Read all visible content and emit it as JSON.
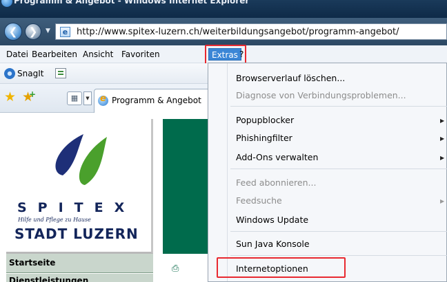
{
  "window": {
    "title": "Programm & Angebot - Windows Internet Explorer"
  },
  "address_bar": {
    "url": "http://www.spitex-luzern.ch/weiterbildungsangebot/programm-angebot/"
  },
  "menu_bar": {
    "items": [
      "Datei",
      "Bearbeiten",
      "Ansicht",
      "Favoriten",
      "Extras",
      "?"
    ],
    "active": "Extras"
  },
  "toolbar": {
    "snagit_label": "SnagIt"
  },
  "favorites_bar": {
    "tab_title": "Programm & Angebot"
  },
  "page": {
    "logo": {
      "word": "SPITEX",
      "tagline": "Hilfe und Pflege zu Hause",
      "city": "STADT LUZERN"
    },
    "nav": [
      "Startseite",
      "Dienstleistungen"
    ],
    "brand_colors": {
      "green": "#006b4c",
      "navy": "#13255a",
      "nav_bg": "#c9d6cc"
    }
  },
  "extras_menu": {
    "items": [
      {
        "label": "Browserverlauf löschen...",
        "enabled": true,
        "submenu": false
      },
      {
        "label": "Diagnose von Verbindungsproblemen...",
        "enabled": false,
        "submenu": false
      },
      {
        "label": "Popupblocker",
        "enabled": true,
        "submenu": true
      },
      {
        "label": "Phishingfilter",
        "enabled": true,
        "submenu": true
      },
      {
        "label": "Add-Ons verwalten",
        "enabled": true,
        "submenu": true
      },
      {
        "label": "Feed abonnieren...",
        "enabled": false,
        "submenu": false
      },
      {
        "label": "Feedsuche",
        "enabled": false,
        "submenu": true
      },
      {
        "label": "Windows Update",
        "enabled": true,
        "submenu": false
      },
      {
        "label": "Sun Java Konsole",
        "enabled": true,
        "submenu": false
      },
      {
        "label": "Internetoptionen",
        "enabled": true,
        "submenu": false,
        "highlighted": true
      }
    ]
  },
  "highlight_color": "#e8282f"
}
